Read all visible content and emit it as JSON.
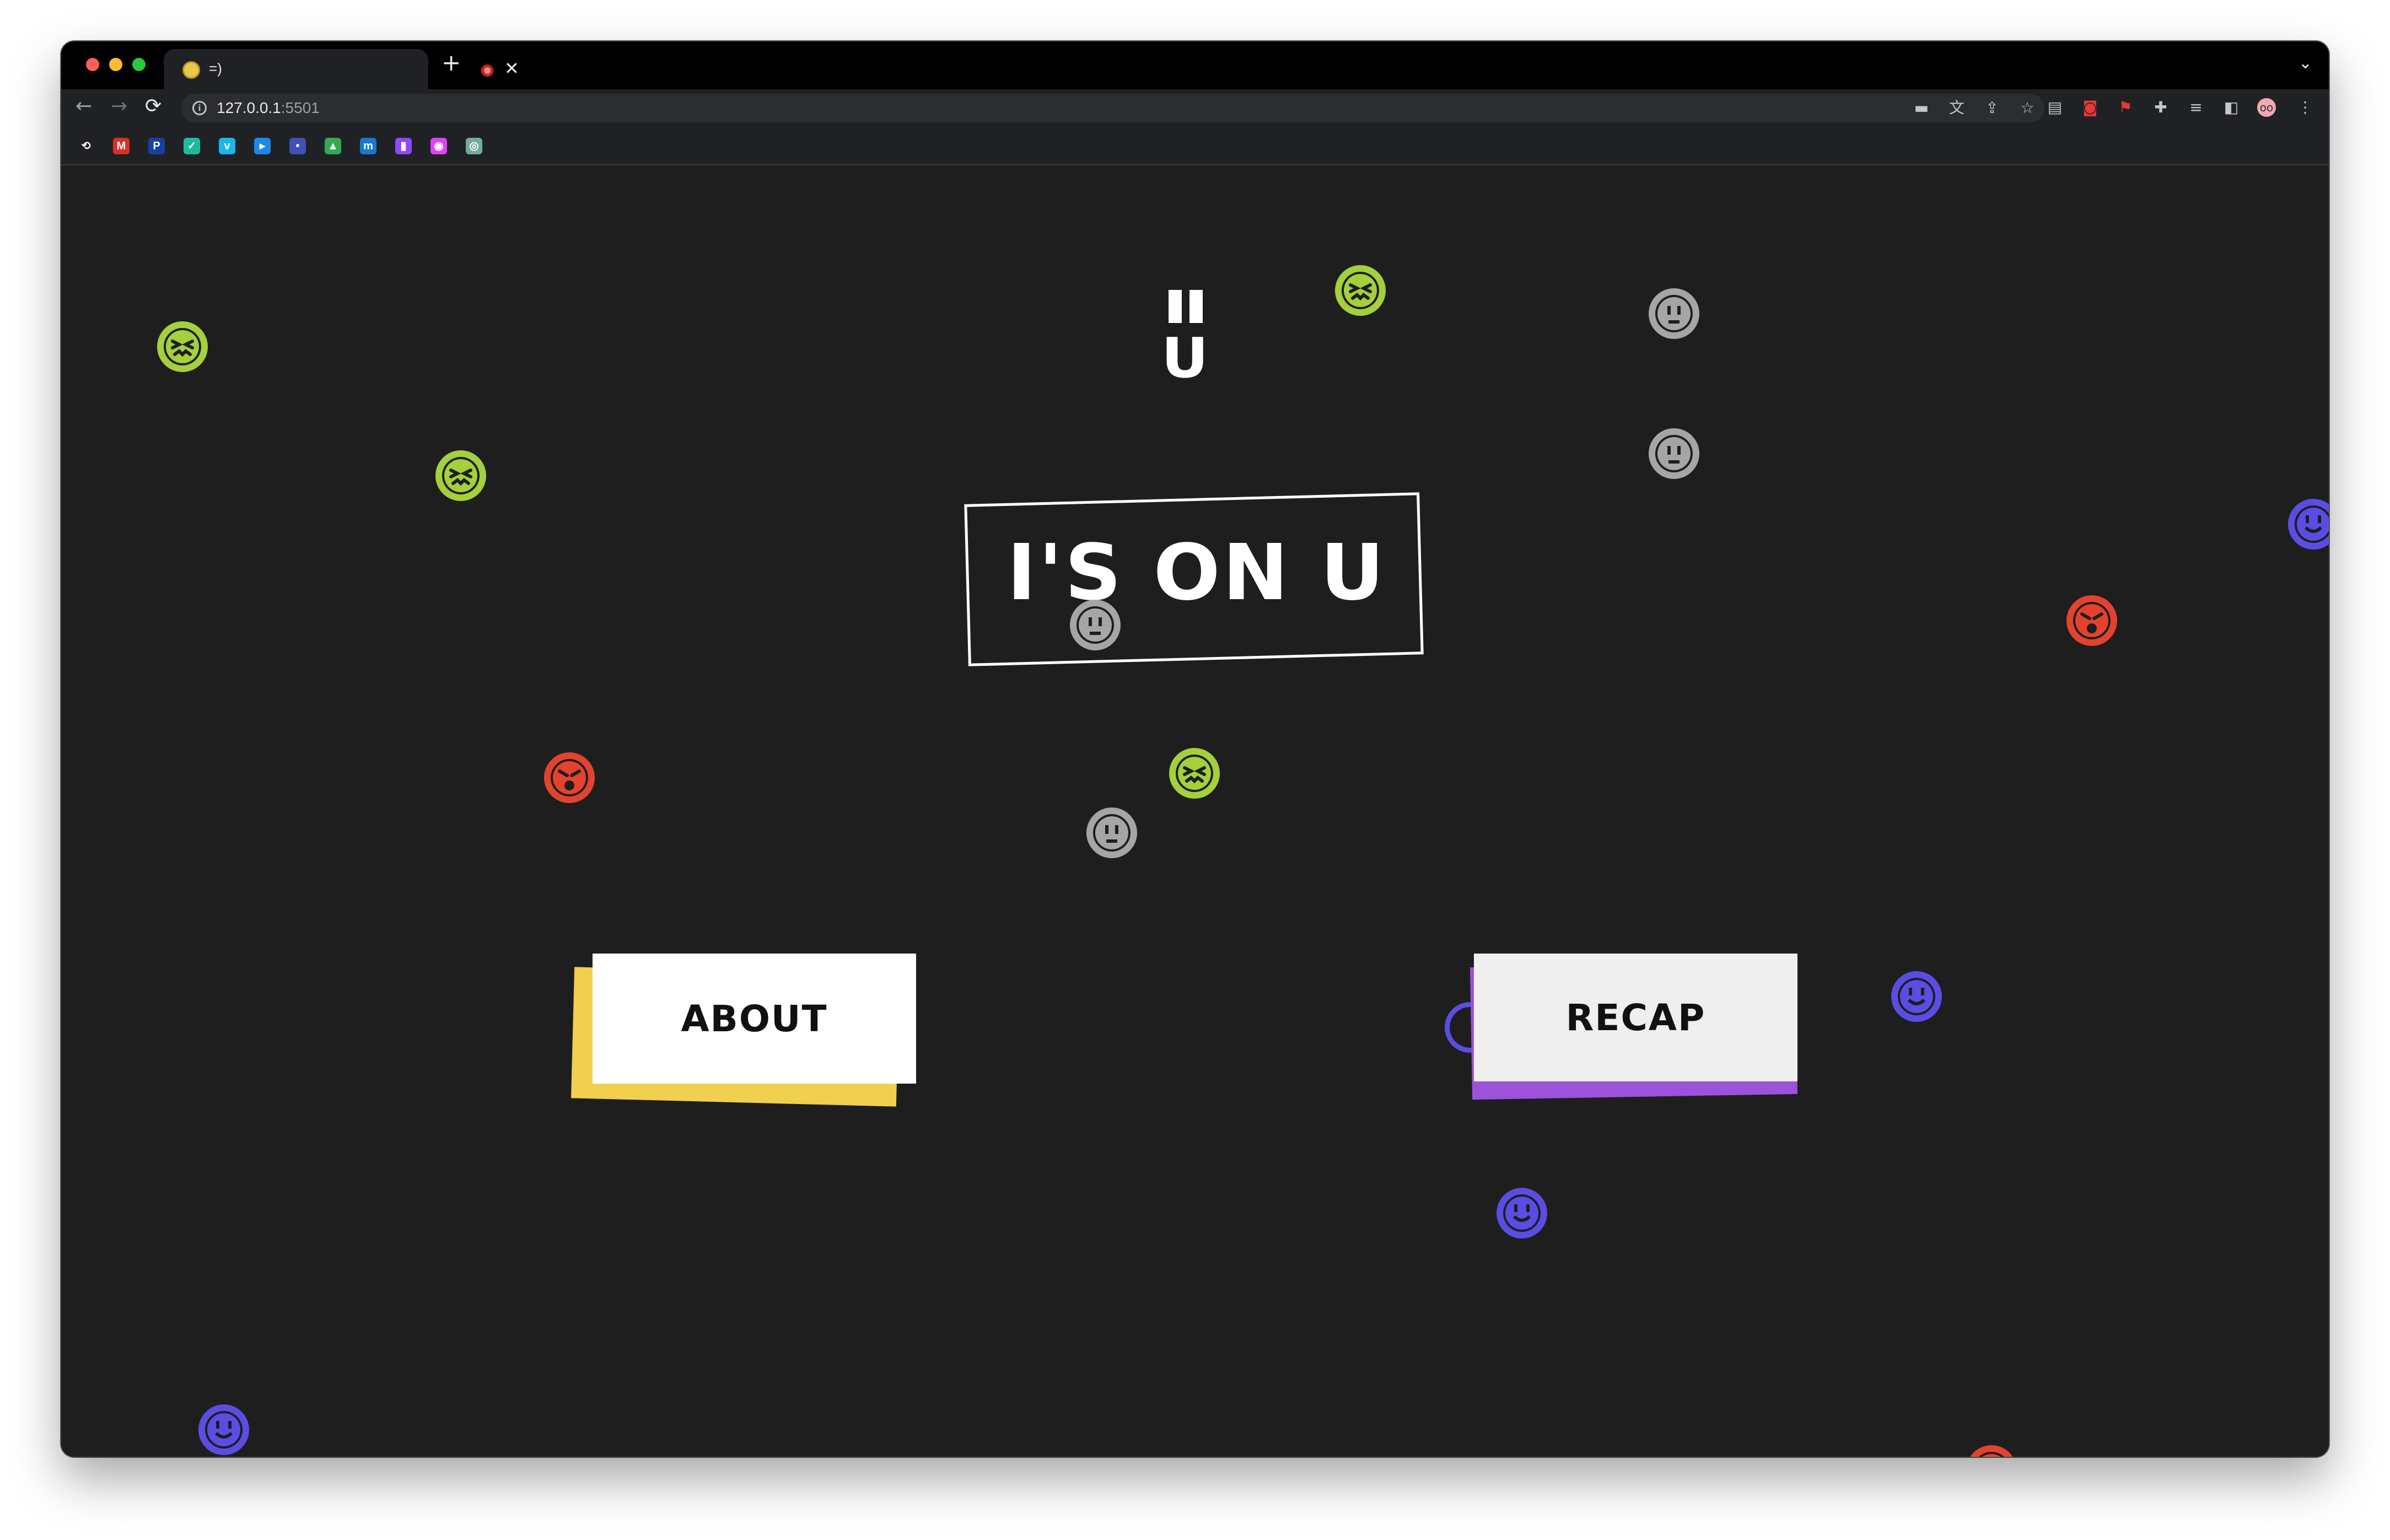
{
  "browser": {
    "tab_title": "=)",
    "tab_close": "✕",
    "new_tab": "+",
    "tab_menu": "⌄",
    "url_host": "127.0.0.1",
    "url_port": ":5501",
    "info_icon": "i",
    "nav": {
      "back": "←",
      "forward": "→",
      "reload": "⟳"
    },
    "colors": {
      "close": "#ff5f57",
      "minimize": "#febc2e",
      "zoom": "#28c840"
    }
  },
  "toolbar_icons": [
    "camera-icon",
    "translate-icon",
    "share-icon",
    "bookmark-star-icon",
    "extension-icon-1",
    "extension-icon-2",
    "acrobat-icon",
    "puzzle-icon",
    "reading-list-icon",
    "side-panel-icon",
    "profile-avatar",
    "menu-icon"
  ],
  "bookmarks": [
    {
      "name": "history-icon",
      "glyph": "⟲",
      "color": "#202124"
    },
    {
      "name": "gmail-icon",
      "glyph": "M",
      "color": "#d93025"
    },
    {
      "name": "pr-icon",
      "glyph": "P",
      "color": "#1a3fa3"
    },
    {
      "name": "check-icon",
      "glyph": "✓",
      "color": "#1abc9c"
    },
    {
      "name": "v-icon",
      "glyph": "v",
      "color": "#1ab7ea"
    },
    {
      "name": "play-icon",
      "glyph": "▸",
      "color": "#1e88e5"
    },
    {
      "name": "bolt-icon",
      "glyph": "•",
      "color": "#3f51b5"
    },
    {
      "name": "drive-icon",
      "glyph": "▲",
      "color": "#34a853"
    },
    {
      "name": "m-icon",
      "glyph": "m",
      "color": "#1976d2"
    },
    {
      "name": "twitch-icon",
      "glyph": "▮",
      "color": "#9146ff"
    },
    {
      "name": "photo-icon",
      "glyph": "◉",
      "color": "#e040fb"
    },
    {
      "name": "chat-icon",
      "glyph": "◎",
      "color": "#74aa9c"
    }
  ],
  "page": {
    "logo_u": "U",
    "title": "I'S ON U",
    "about_label": "ABOUT",
    "recap_label": "RECAP"
  },
  "colors": {
    "background": "#1e1e1e",
    "green": "#a4d03c",
    "gray": "#a5a5a5",
    "red": "#e3432e",
    "blue": "#5b4de3",
    "purple": "#a55ee0",
    "about_shadow": "#f1cf4f",
    "recap_shadow": "#9c52db",
    "about_face": "#ffffff",
    "recap_face": "#efefef"
  },
  "faces": [
    {
      "color": "green",
      "mood": "squint"
    },
    {
      "color": "green",
      "mood": "squint"
    },
    {
      "color": "green",
      "mood": "squint"
    },
    {
      "color": "green",
      "mood": "squint"
    },
    {
      "color": "gray",
      "mood": "neutral"
    },
    {
      "color": "gray",
      "mood": "neutral"
    },
    {
      "color": "gray",
      "mood": "neutral"
    },
    {
      "color": "gray",
      "mood": "neutral"
    },
    {
      "color": "red",
      "mood": "angry"
    },
    {
      "color": "red",
      "mood": "angry"
    },
    {
      "color": "red",
      "mood": "angry"
    },
    {
      "color": "blue",
      "mood": "smile"
    },
    {
      "color": "blue",
      "mood": "smile"
    },
    {
      "color": "blue",
      "mood": "smile"
    },
    {
      "color": "blue",
      "mood": "smile"
    },
    {
      "color": "purple",
      "mood": "wink"
    }
  ]
}
